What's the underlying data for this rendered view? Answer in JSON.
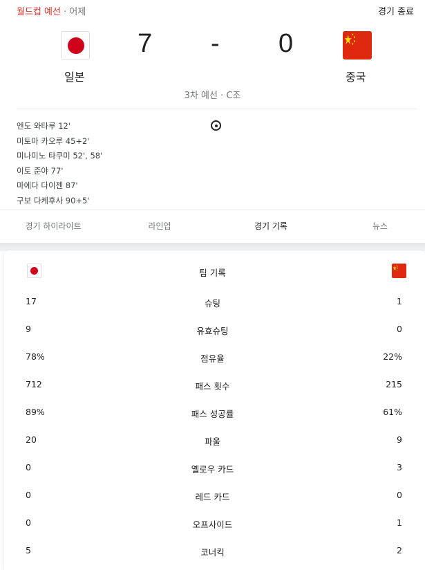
{
  "header": {
    "competition": "월드컵 예선",
    "separator": " · ",
    "date": "어제",
    "status": "경기 종료"
  },
  "match": {
    "home_team": "일본",
    "away_team": "중국",
    "home_score": "7",
    "score_separator": "-",
    "away_score": "0",
    "round": "3차 예선 · C조",
    "home_flag_icon": "japan-flag-icon",
    "away_flag_icon": "china-flag-icon"
  },
  "scorers": [
    "엔도 와타루 12'",
    "미토마 카오루 45+2'",
    "미나미노 타쿠미 52', 58'",
    "이토 준야 77'",
    "마에다 다이젠 87'",
    "구보 다케후사 90+5'"
  ],
  "tabs": [
    {
      "label": "경기 하이라이트",
      "active": false
    },
    {
      "label": "라인업",
      "active": false
    },
    {
      "label": "경기 기록",
      "active": true
    },
    {
      "label": "뉴스",
      "active": false
    }
  ],
  "stats": {
    "title": "팀 기록",
    "rows": [
      {
        "home": "17",
        "label": "슈팅",
        "away": "1"
      },
      {
        "home": "9",
        "label": "유효슈팅",
        "away": "0"
      },
      {
        "home": "78%",
        "label": "점유율",
        "away": "22%"
      },
      {
        "home": "712",
        "label": "패스 횟수",
        "away": "215"
      },
      {
        "home": "89%",
        "label": "패스 성공률",
        "away": "61%"
      },
      {
        "home": "20",
        "label": "파울",
        "away": "9"
      },
      {
        "home": "0",
        "label": "옐로우 카드",
        "away": "3"
      },
      {
        "home": "0",
        "label": "레드 카드",
        "away": "0"
      },
      {
        "home": "0",
        "label": "오프사이드",
        "away": "1"
      },
      {
        "home": "5",
        "label": "코너킥",
        "away": "2"
      }
    ]
  },
  "colors": {
    "competition_red": "#d93025",
    "japan_red": "#d0021b",
    "china_red": "#de2910",
    "china_star": "#ffde00"
  }
}
